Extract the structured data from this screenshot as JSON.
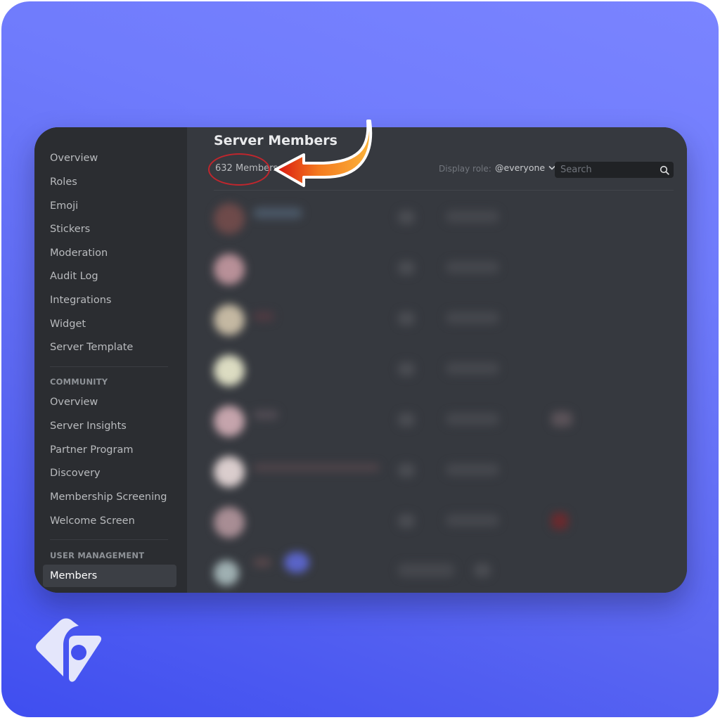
{
  "sidebar": {
    "items": [
      {
        "label": "Overview"
      },
      {
        "label": "Roles"
      },
      {
        "label": "Emoji"
      },
      {
        "label": "Stickers"
      },
      {
        "label": "Moderation"
      },
      {
        "label": "Audit Log"
      },
      {
        "label": "Integrations"
      },
      {
        "label": "Widget"
      },
      {
        "label": "Server Template"
      }
    ],
    "community": {
      "header": "COMMUNITY",
      "items": [
        {
          "label": "Overview"
        },
        {
          "label": "Server Insights"
        },
        {
          "label": "Partner Program"
        },
        {
          "label": "Discovery"
        },
        {
          "label": "Membership Screening"
        },
        {
          "label": "Welcome Screen"
        }
      ]
    },
    "user_management": {
      "header": "USER MANAGEMENT",
      "items": [
        {
          "label": "Members",
          "active": true
        }
      ]
    }
  },
  "main": {
    "title": "Server Members",
    "member_count": "632 Members",
    "display_role_label": "Display role:",
    "display_role_value": "@everyone",
    "search": {
      "placeholder": "Search",
      "value": ""
    },
    "member_rows_blurred": 8
  },
  "annotation": {
    "highlight_color": "#c0262d",
    "arrow_gradient": [
      "#d8140f",
      "#f47a1f",
      "#fbb33a"
    ]
  },
  "colors": {
    "background_gradient": [
      "#7a84ff",
      "#3f4ef0"
    ],
    "sidebar_bg": "#2b2d31",
    "main_bg": "#36393f",
    "logo_fill": "#e4e6fb"
  }
}
